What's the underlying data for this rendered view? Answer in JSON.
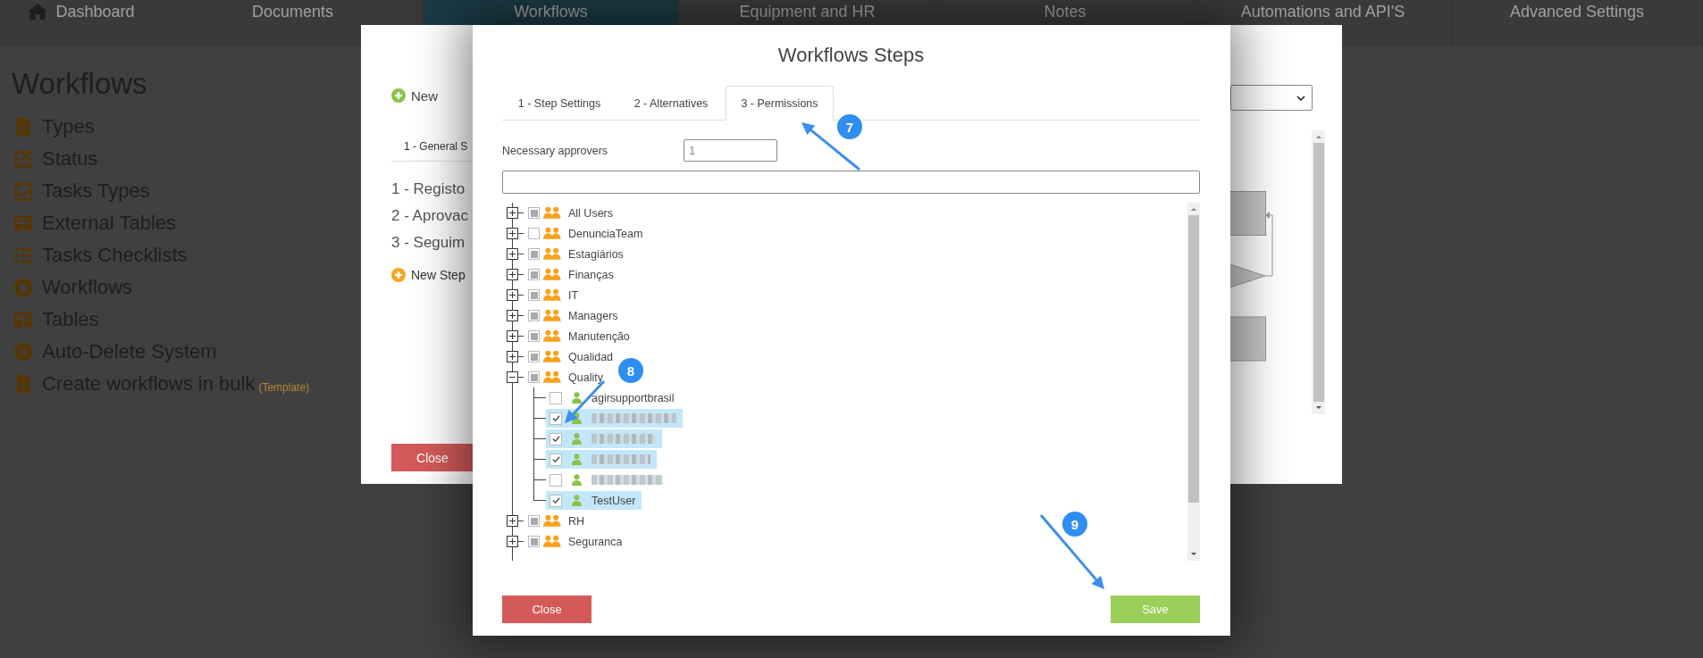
{
  "nav": [
    {
      "label": "Dashboard",
      "selected": false
    },
    {
      "label": "Documents",
      "selected": false
    },
    {
      "label": "Workflows",
      "selected": true
    },
    {
      "label": "Equipment and HR",
      "selected": false
    },
    {
      "label": "Notes",
      "selected": false
    },
    {
      "label": "Automations and API'S",
      "selected": false
    },
    {
      "label": "Advanced Settings",
      "selected": false
    }
  ],
  "sidebar": {
    "title": "Workflows",
    "items": [
      {
        "label": "Types"
      },
      {
        "label": "Status"
      },
      {
        "label": "Tasks Types"
      },
      {
        "label": "External Tables"
      },
      {
        "label": "Tasks Checklists"
      },
      {
        "label": "Workflows"
      },
      {
        "label": "Tables"
      },
      {
        "label": "Auto-Delete System"
      },
      {
        "label": "Create workflows in bulk",
        "note": "(Template)"
      }
    ]
  },
  "back_dialog": {
    "new_button": "New",
    "tab": "1 - General S",
    "steps": [
      "1 - Registo",
      "2 - Aprovac",
      "3 - Seguim"
    ],
    "new_step_button": "New Step",
    "close_button": "Close"
  },
  "dialog": {
    "title": "Workflows Steps",
    "tabs": [
      {
        "label": "1 - Step Settings",
        "selected": false
      },
      {
        "label": "2 - Alternatives",
        "selected": false
      },
      {
        "label": "3 - Permissions",
        "selected": true
      }
    ],
    "approvers": {
      "label": "Necessary approvers",
      "value": "1"
    },
    "tree": [
      {
        "label": "All Users",
        "expanded": false,
        "checked": false,
        "indeterminate": true
      },
      {
        "label": "DenunciaTeam",
        "expanded": false,
        "checked": false,
        "indeterminate": false
      },
      {
        "label": "Estagiários",
        "expanded": false,
        "checked": false,
        "indeterminate": true
      },
      {
        "label": "Finanças",
        "expanded": false,
        "checked": false,
        "indeterminate": true
      },
      {
        "label": "IT",
        "expanded": false,
        "checked": false,
        "indeterminate": true
      },
      {
        "label": "Managers",
        "expanded": false,
        "checked": false,
        "indeterminate": true
      },
      {
        "label": "Manutenção",
        "expanded": false,
        "checked": false,
        "indeterminate": true
      },
      {
        "label": "Qualidad",
        "expanded": false,
        "checked": false,
        "indeterminate": true
      },
      {
        "label": "Quality",
        "expanded": true,
        "checked": false,
        "indeterminate": true,
        "children": [
          {
            "kind": "user",
            "label": "agirsupportbrasil",
            "checked": false
          },
          {
            "kind": "redacted",
            "checked": true
          },
          {
            "kind": "redacted",
            "checked": true
          },
          {
            "kind": "redacted",
            "checked": true
          },
          {
            "kind": "redacted",
            "checked": false
          },
          {
            "kind": "user",
            "label": "TestUser",
            "checked": true
          }
        ]
      },
      {
        "label": "RH",
        "expanded": false,
        "checked": false,
        "indeterminate": true
      },
      {
        "label": "Seguranca",
        "expanded": false,
        "checked": false,
        "indeterminate": true
      }
    ],
    "close_button": "Close",
    "save_button": "Save"
  },
  "annotations": [
    {
      "number": "7"
    },
    {
      "number": "8"
    },
    {
      "number": "9"
    }
  ]
}
